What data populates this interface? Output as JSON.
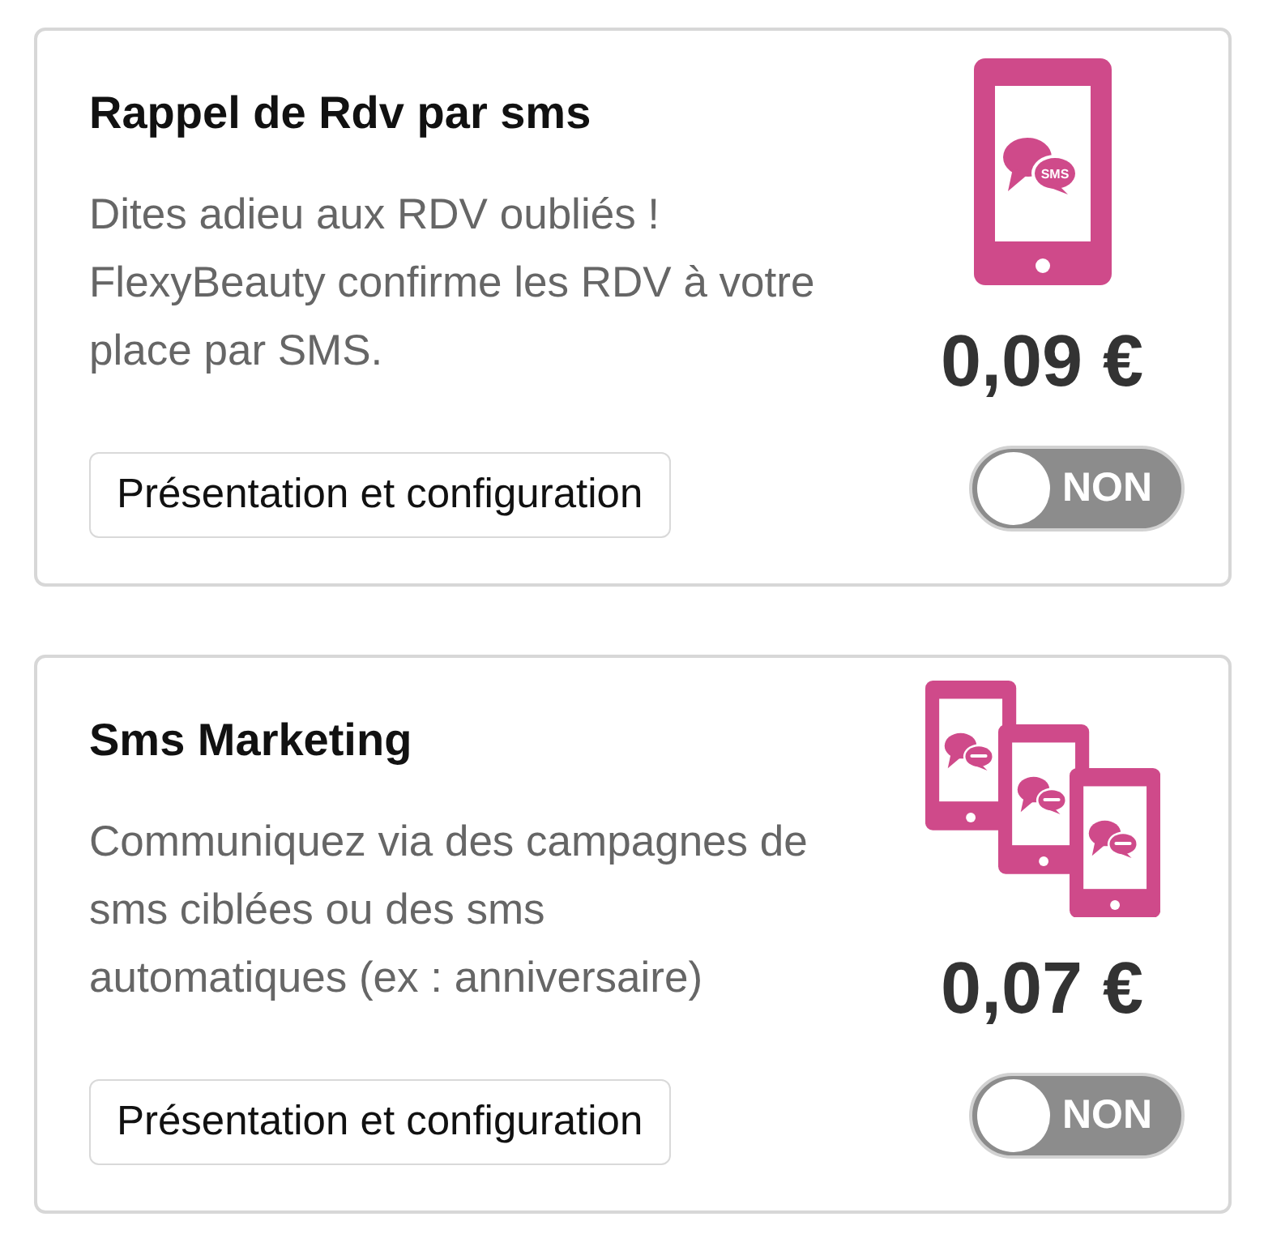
{
  "cards": [
    {
      "kind": "phone",
      "title": "Rappel de Rdv par sms",
      "description": "Dites adieu aux RDV oubliés !\nFlexyBeauty confirme les RDV à votre\nplace par SMS.",
      "icon_text": "SMS",
      "button": "Présentation et configuration",
      "price": "0,09 €",
      "toggle": {
        "on": false,
        "label": "NON"
      }
    },
    {
      "kind": "phones",
      "title": "Sms Marketing",
      "description": "Communiquez via des campagnes de\nsms ciblées ou des sms\nautomatiques (ex : anniversaire)",
      "button": "Présentation et configuration",
      "price": "0,07 €",
      "toggle": {
        "on": false,
        "label": "NON"
      }
    }
  ]
}
